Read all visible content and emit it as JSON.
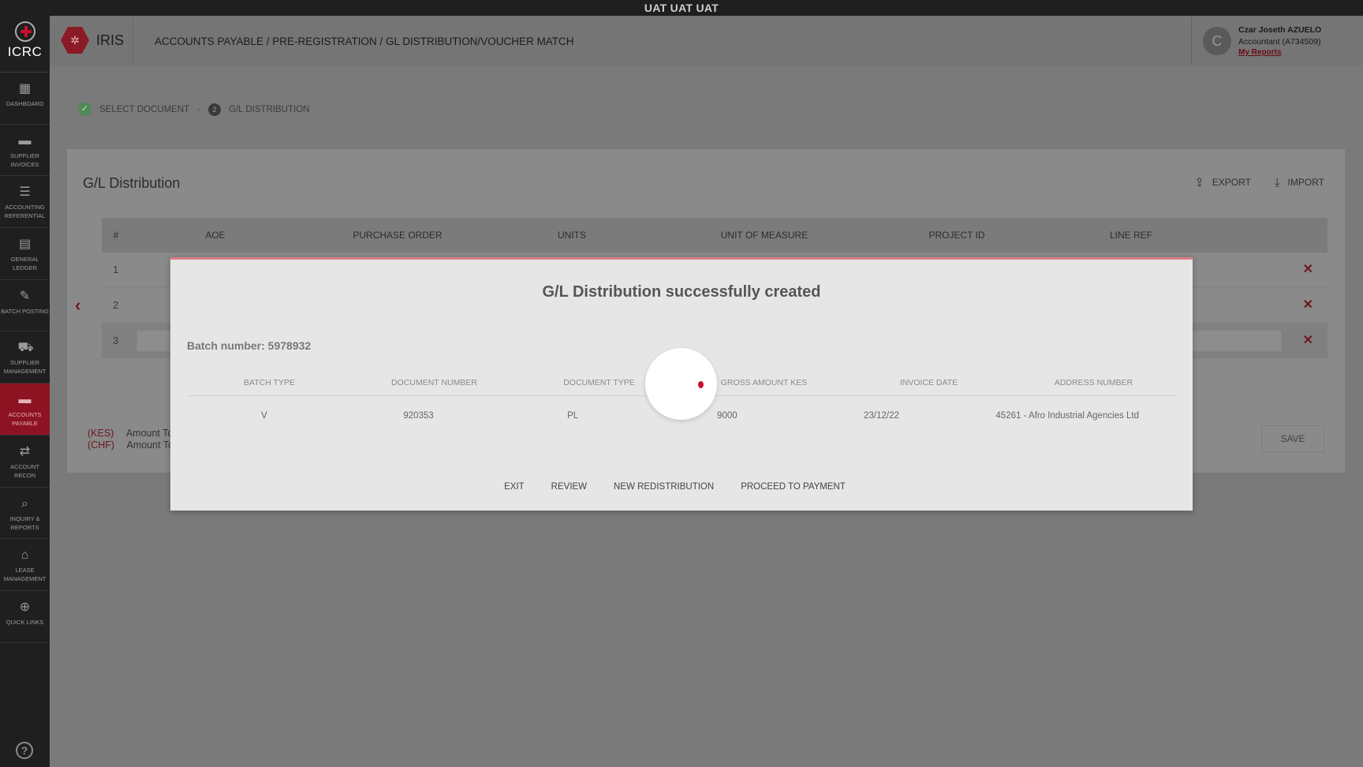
{
  "env_banner": "UAT UAT UAT",
  "sidebar": {
    "logo_text": "ICRC",
    "items": [
      {
        "label": "DASHBOARD",
        "icon": "dashboard-icon"
      },
      {
        "label": "SUPPLIER INVOICES",
        "icon": "briefcase-icon"
      },
      {
        "label": "ACCOUNTING REFERENTIAL",
        "icon": "list-icon"
      },
      {
        "label": "GENERAL LEDGER",
        "icon": "book-icon"
      },
      {
        "label": "BATCH POSTING",
        "icon": "wrench-icon"
      },
      {
        "label": "SUPPLIER MANAGEMENT",
        "icon": "truck-icon"
      },
      {
        "label": "ACCOUNTS PAYABLE",
        "icon": "briefcase-icon",
        "active": true
      },
      {
        "label": "ACCOUNT RECON",
        "icon": "arrows-icon"
      },
      {
        "label": "INQUIRY & REPORTS",
        "icon": "search-icon"
      },
      {
        "label": "LEASE MANAGEMENT",
        "icon": "store-icon"
      },
      {
        "label": "QUICK LINKS",
        "icon": "globe-icon"
      }
    ],
    "help_icon": "?"
  },
  "header": {
    "app_name": "IRIS",
    "breadcrumb": "ACCOUNTS PAYABLE / PRE-REGISTRATION / GL DISTRIBUTION/VOUCHER MATCH",
    "user": {
      "initial": "C",
      "name": "Czar Joseth AZUELO",
      "role": "Accountant (A734509)",
      "link": "My Reports"
    }
  },
  "stepper": {
    "step1": "SELECT DOCUMENT",
    "step2_number": "2",
    "step2": "G/L DISTRIBUTION"
  },
  "card": {
    "title": "G/L Distribution",
    "export_label": "EXPORT",
    "import_label": "IMPORT",
    "columns": [
      "#",
      "AOE",
      "PURCHASE ORDER",
      "UNITS",
      "UNIT OF MEASURE",
      "PROJECT ID",
      "LINE REF"
    ],
    "rows": [
      "1",
      "2",
      "3"
    ],
    "totals": [
      {
        "currency": "(KES)",
        "label": "Amount To"
      },
      {
        "currency": "(CHF)",
        "label": "Amount To"
      }
    ],
    "save_label": "SAVE"
  },
  "modal": {
    "title": "G/L Distribution successfully created",
    "batch_label": "Batch number: 5978932",
    "columns": [
      "BATCH TYPE",
      "DOCUMENT NUMBER",
      "DOCUMENT TYPE",
      "GROSS AMOUNT KES",
      "INVOICE DATE",
      "ADDRESS NUMBER"
    ],
    "row": [
      "V",
      "920353",
      "PL",
      "9000",
      "23/12/22",
      "45261 - Afro Industrial Agencies Ltd"
    ],
    "actions": [
      "EXIT",
      "REVIEW",
      "NEW REDISTRIBUTION",
      "PROCEED TO PAYMENT"
    ]
  },
  "colors": {
    "brand_red": "#c8102e",
    "active_nav": "#8e1322"
  }
}
